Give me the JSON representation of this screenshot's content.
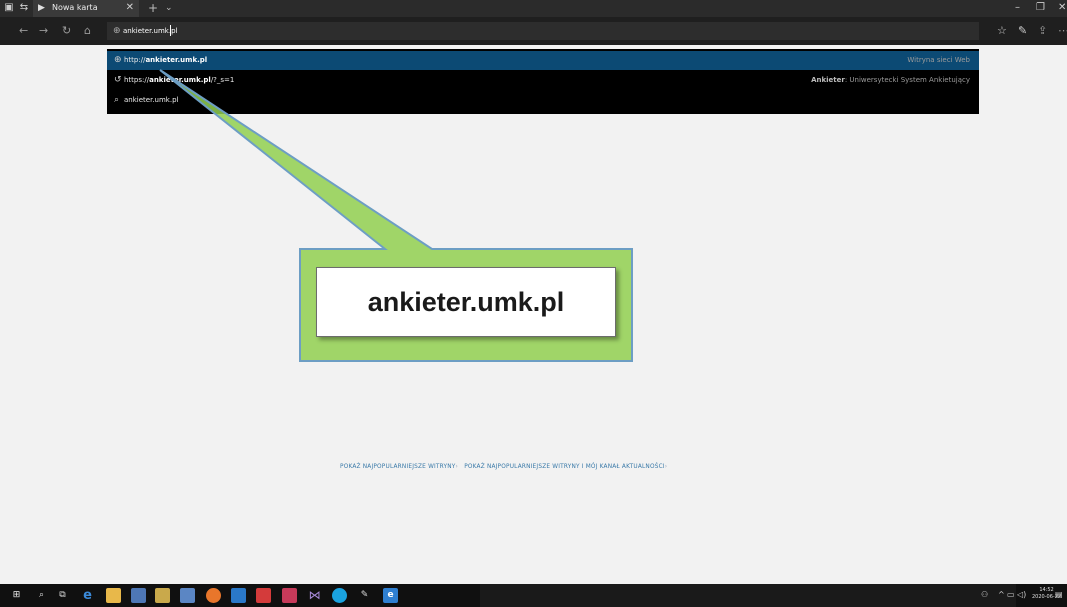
{
  "tab": {
    "title": "Nowa karta"
  },
  "address_bar": {
    "value": "ankieter.umk.pl"
  },
  "suggestions": [
    {
      "prefix": "http://",
      "bold": "ankieter.umk.pl",
      "suffix": "",
      "right_bold": "",
      "right": "Witryna sieci Web",
      "icon": "globe-icon",
      "selected": true
    },
    {
      "prefix": "https://",
      "bold": "ankieter.umk.pl",
      "suffix": "/?_s=1",
      "right_bold": "Ankieter",
      "right": ": Uniwersytecki System Ankietujący",
      "icon": "history-icon",
      "selected": false
    },
    {
      "prefix": "",
      "bold": "",
      "suffix": "ankieter.umk.pl",
      "right_bold": "",
      "right": "",
      "icon": "search-icon",
      "selected": false
    }
  ],
  "callout": {
    "text": "ankieter.umk.pl"
  },
  "links": {
    "top_sites": "POKAŻ NAJPOPULARNIEJSZE WITRYNY",
    "top_sites_and_feed": "POKAŻ NAJPOPULARNIEJSZE WITRYNY I MÓJ KANAŁ AKTUALNOŚCI"
  },
  "clock": {
    "time": "14:52",
    "date": "2020-06-22"
  },
  "colors": {
    "selected_suggestion": "#0c4a74",
    "callout_fill": "#92d050",
    "link": "#3979a8",
    "taskbar": "#101010"
  }
}
